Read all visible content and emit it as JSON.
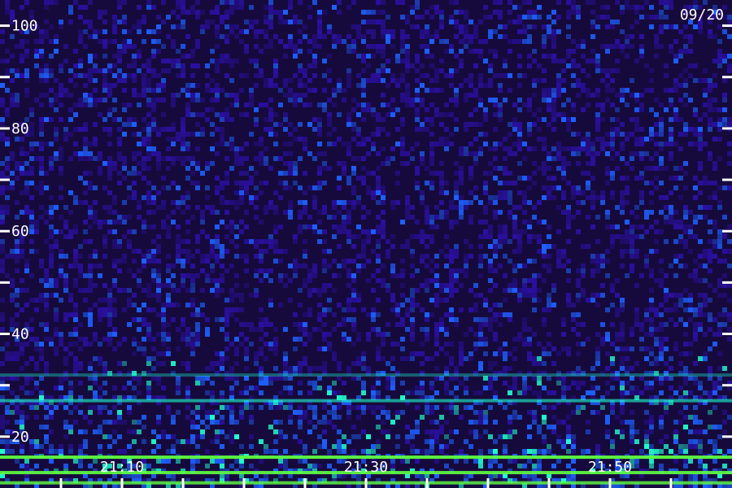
{
  "chart_data": {
    "type": "heatmap",
    "title": "",
    "xlabel": "",
    "ylabel": "",
    "date_label": "09/20",
    "y_ticks": [
      100,
      80,
      60,
      40,
      20
    ],
    "ylim": [
      10,
      105
    ],
    "x_ticks": [
      "21:10",
      "21:30",
      "21:50"
    ],
    "grid": false,
    "colors": {
      "background": "#1a0a4a",
      "low": "#2a10a0",
      "mid": "#1e60ff",
      "high": "#20ffd0",
      "peak": "#60ff40",
      "text": "#ffffff"
    },
    "features": [
      {
        "name": "band",
        "freq": 16,
        "strength": 0.95
      },
      {
        "name": "band",
        "freq": 13,
        "strength": 0.9
      },
      {
        "name": "band",
        "freq": 27,
        "strength": 0.6
      },
      {
        "name": "band",
        "freq": 32,
        "strength": 0.35
      },
      {
        "name": "band",
        "freq": 11,
        "strength": 0.8
      }
    ]
  }
}
